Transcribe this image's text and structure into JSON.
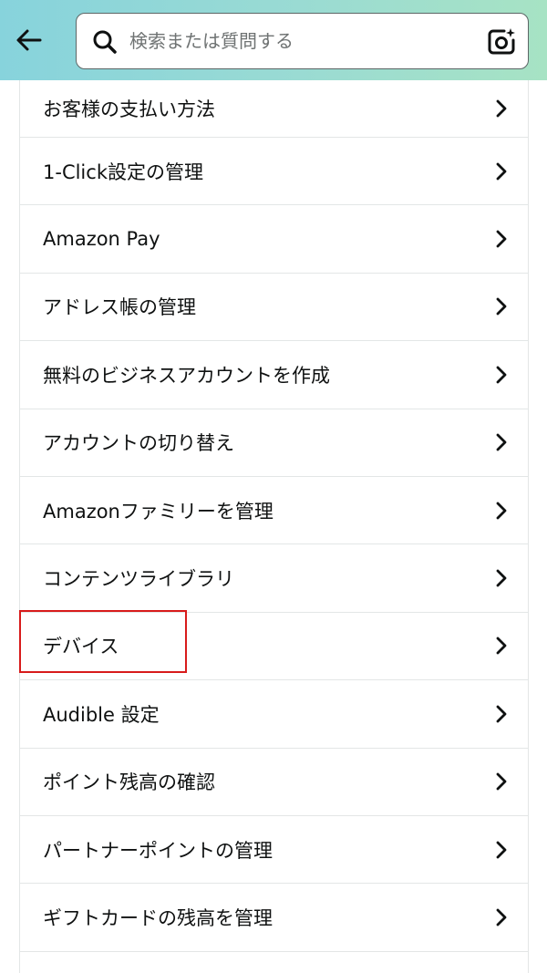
{
  "header": {
    "back_icon": "arrow-left-icon",
    "search": {
      "placeholder": "検索または質問する",
      "value": "",
      "icon": "search-icon",
      "camera_icon": "camera-lens-icon"
    },
    "gradient_colors": [
      "#87d3dc",
      "#a7e3c4"
    ]
  },
  "menu": {
    "items": [
      {
        "label": "お客様の支払い方法"
      },
      {
        "label": "1-Click設定の管理"
      },
      {
        "label": "Amazon Pay"
      },
      {
        "label": "アドレス帳の管理"
      },
      {
        "label": "無料のビジネスアカウントを作成"
      },
      {
        "label": "アカウントの切り替え"
      },
      {
        "label": "Amazonファミリーを管理"
      },
      {
        "label": "コンテンツライブラリ"
      },
      {
        "label": "デバイス"
      },
      {
        "label": "Audible 設定"
      },
      {
        "label": "ポイント残高の確認"
      },
      {
        "label": "パートナーポイントの管理"
      },
      {
        "label": "ギフトカードの残高を管理"
      },
      {
        "label": ""
      }
    ],
    "chevron_icon": "chevron-right-icon",
    "highlighted_item": "デバイス",
    "highlight_color": "#d81b1b"
  }
}
